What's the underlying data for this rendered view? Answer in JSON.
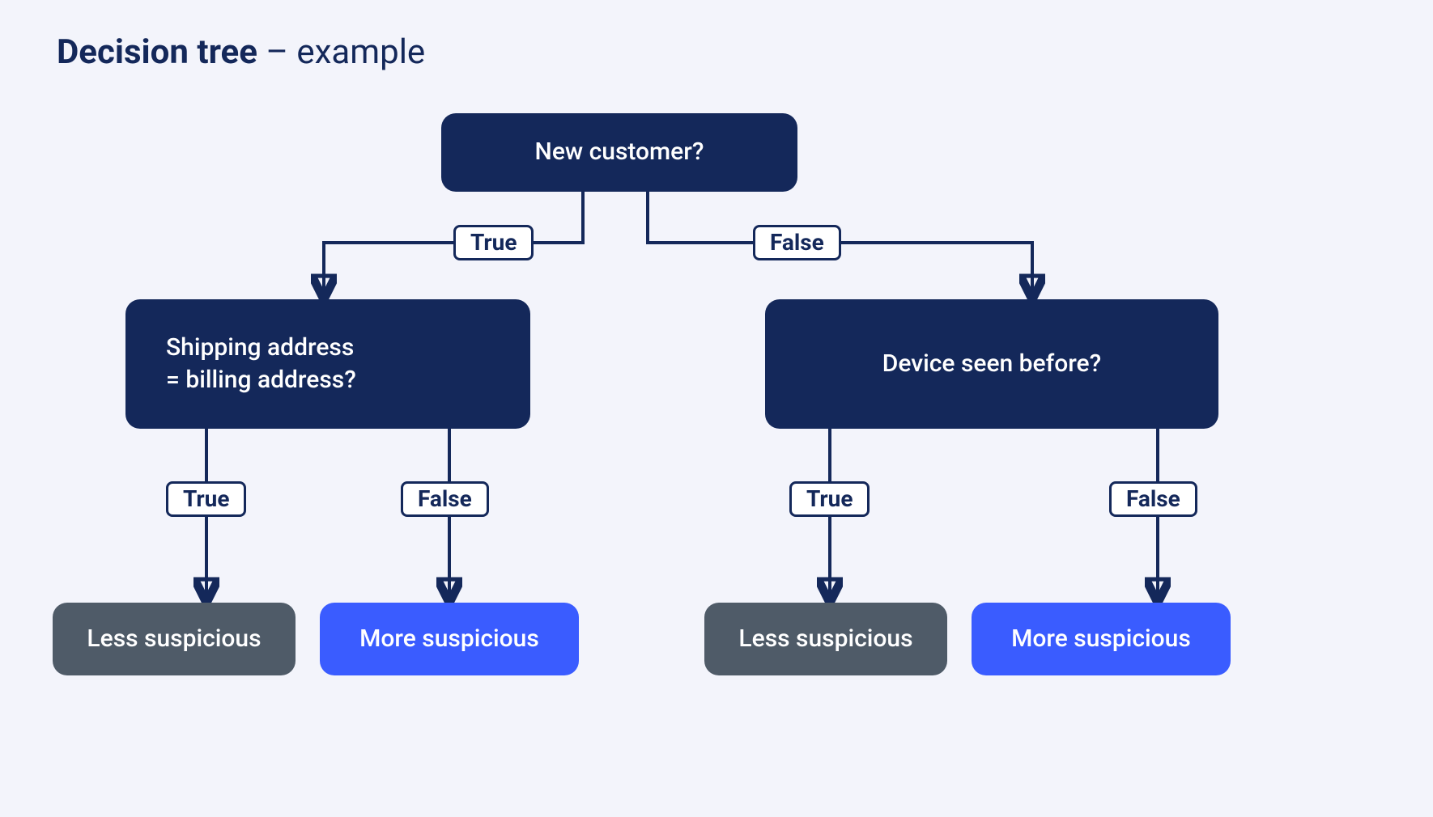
{
  "title_bold": "Decision tree",
  "title_rest": " – example",
  "nodes": {
    "root": "New customer?",
    "left": "Shipping address\n= billing address?",
    "right": "Device seen before?",
    "leaf_less": "Less suspicious",
    "leaf_more": "More suspicious"
  },
  "labels": {
    "true": "True",
    "false": "False"
  },
  "colors": {
    "dark": "#14285a",
    "gray": "#4f5b68",
    "blue": "#3a5cff",
    "bg": "#f3f4fb"
  }
}
